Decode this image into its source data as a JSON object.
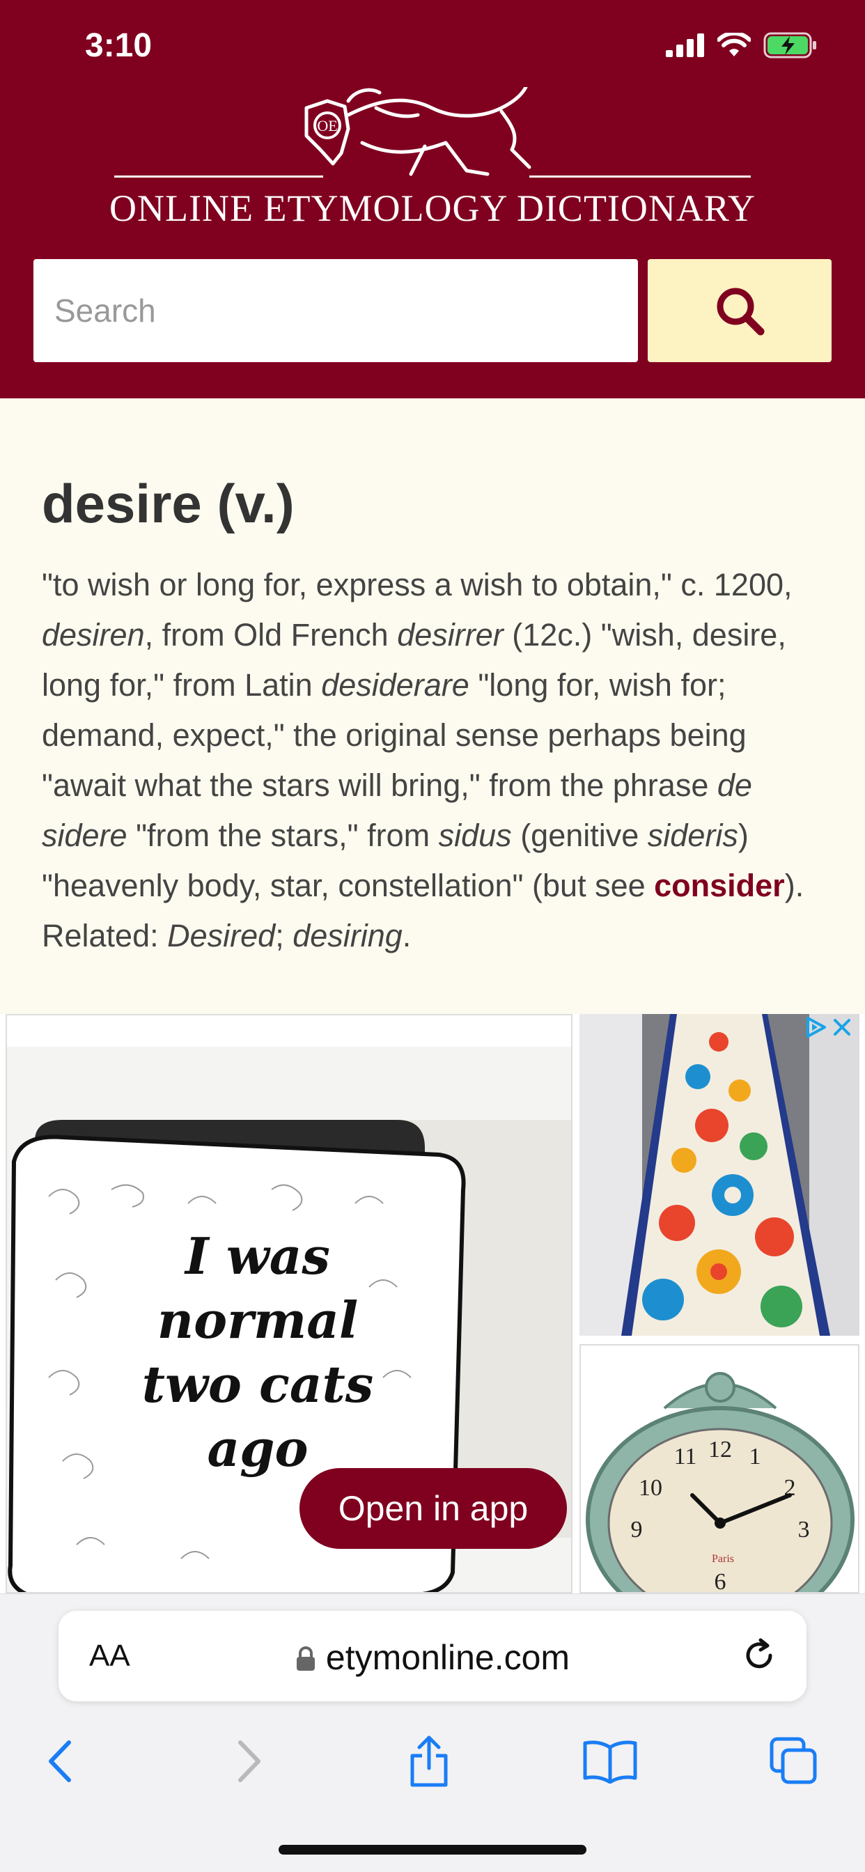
{
  "status": {
    "time": "3:10"
  },
  "site": {
    "title": "ONLINE ETYMOLOGY DICTIONARY",
    "logo_monogram": "OE"
  },
  "search": {
    "placeholder": "Search"
  },
  "entry": {
    "title": "desire (v.)",
    "t1": "\"to wish or long for, express a wish to obtain,\" c. 1200, ",
    "i1": "desiren",
    "t2": ", from Old French ",
    "i2": "desirrer",
    "t3": " (12c.) \"wish, desire, long for,\" from Latin ",
    "i3": "desiderare",
    "t4": " \"long for, wish for; demand, expect,\" the original sense perhaps being \"await what the stars will bring,\" from the phrase ",
    "i4": "de sidere",
    "t5": " \"from the stars,\" from ",
    "i5": "sidus",
    "t6": " (genitive ",
    "i6": "sideris",
    "t7": ") \"heavenly body, star, constellation\" (but see ",
    "link": "consider",
    "t8": "). Related: ",
    "i7": "Desired",
    "t9": "; ",
    "i8": "desiring",
    "t10": "."
  },
  "ad": {
    "pillow_text": [
      "I was",
      "normal",
      "two cats",
      "ago"
    ],
    "open_app_label": "Open in app",
    "clock_paris": "Paris"
  },
  "browser": {
    "aa_label": "AA",
    "url": "etymonline.com"
  },
  "colors": {
    "brand": "#80001f",
    "search_button": "#fdf2c2",
    "page_bg": "#fdfbef"
  }
}
